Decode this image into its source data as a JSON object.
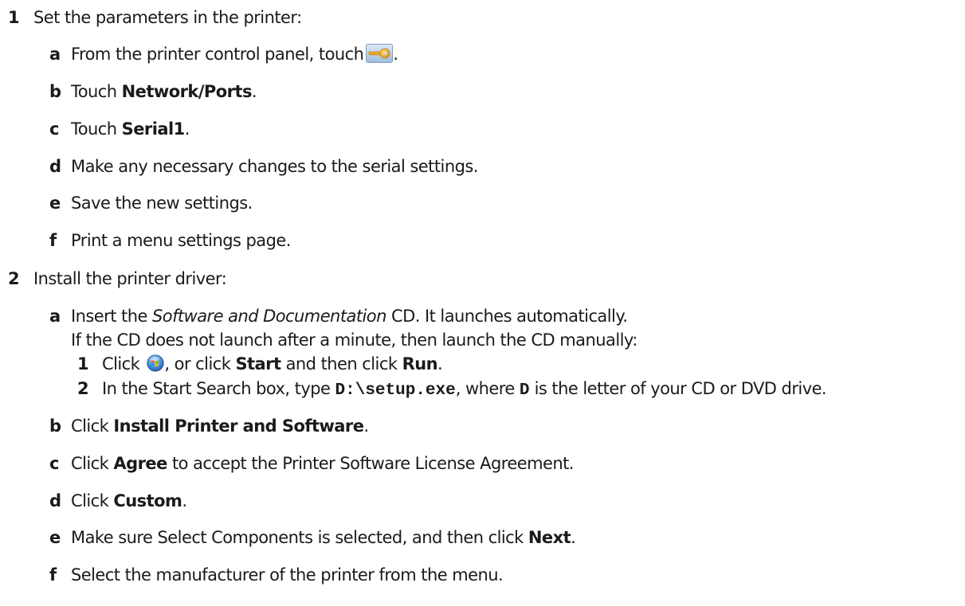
{
  "steps": [
    {
      "number": "1",
      "text": "Set the parameters in the printer:",
      "substeps": [
        {
          "letter": "a",
          "text_before": "From the printer control panel, touch",
          "text_after": ".",
          "icon": "key-icon"
        },
        {
          "letter": "b",
          "text_before": "Touch ",
          "bold": "Network/Ports",
          "text_after": "."
        },
        {
          "letter": "c",
          "text_before": "Touch ",
          "bold": "Serial1",
          "text_after": "."
        },
        {
          "letter": "d",
          "text": "Make any necessary changes to the serial settings."
        },
        {
          "letter": "e",
          "text": "Save the new settings."
        },
        {
          "letter": "f",
          "text": "Print a menu settings page."
        }
      ]
    },
    {
      "number": "2",
      "text": "Install the printer driver:",
      "substeps": [
        {
          "letter": "a",
          "text_before": "Insert the ",
          "italic": "Software and Documentation",
          "text_after": " CD. It launches automatically.",
          "note": "If the CD does not launch after a minute, then launch the CD manually:",
          "items": [
            {
              "number": "1",
              "t1": "Click ",
              "icon": "windows-start-icon",
              "t2": ", or click ",
              "b1": "Start",
              "t3": " and then click ",
              "b2": "Run",
              "t4": "."
            },
            {
              "number": "2",
              "t1": "In the Start Search box, type ",
              "code1": "D:\\setup.exe",
              "t2": ", where ",
              "code2": "D",
              "t3": " is the letter of your CD or DVD drive."
            }
          ]
        },
        {
          "letter": "b",
          "text_before": "Click ",
          "bold": "Install Printer and Software",
          "text_after": "."
        },
        {
          "letter": "c",
          "text_before": "Click ",
          "bold": "Agree",
          "text_after": " to accept the Printer Software License Agreement."
        },
        {
          "letter": "d",
          "text_before": "Click ",
          "bold": "Custom",
          "text_after": "."
        },
        {
          "letter": "e",
          "text_before": "Make sure Select Components is selected, and then click ",
          "bold": "Next",
          "text_after": "."
        },
        {
          "letter": "f",
          "text": "Select the manufacturer of the printer from the menu."
        }
      ]
    }
  ],
  "colors": {
    "text": "#1a1a1a",
    "key_icon_body": "#e8a31c",
    "key_icon_bg": "#b9d1e9",
    "windows_orb": "#3a7fd0"
  }
}
